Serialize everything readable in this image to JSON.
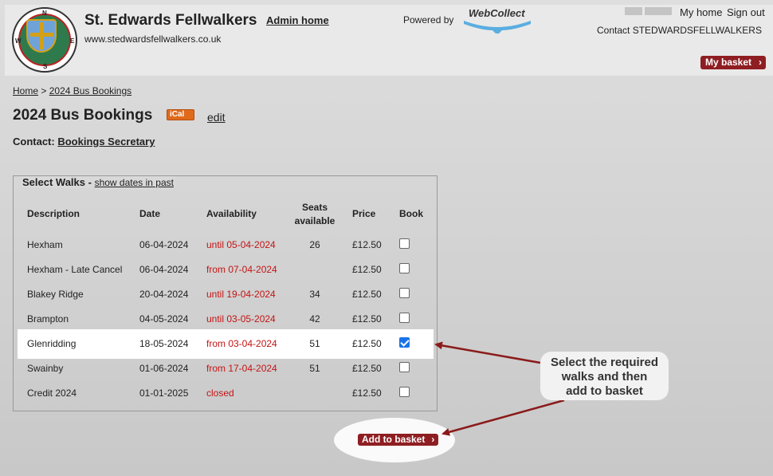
{
  "header": {
    "logo_letters": {
      "n": "N",
      "s": "S",
      "w": "W",
      "e": "E"
    },
    "site_title": "St. Edwards Fellwalkers",
    "admin_home": "Admin home",
    "site_url": "www.stedwardsfellwalkers.co.uk",
    "powered_by": "Powered by",
    "brand_logo_text": "WebCollect",
    "my_home": "My home",
    "sign_out": "Sign out",
    "contact": "Contact STEDWARDSFELLWALKERS",
    "basket_label": "My basket"
  },
  "breadcrumb": {
    "home": "Home",
    "separator": ">",
    "current": "2024 Bus Bookings"
  },
  "page": {
    "title": "2024 Bus Bookings",
    "ical_label": "iCal",
    "edit_label": "edit",
    "contact_label": "Contact:",
    "contact_name": "Bookings Secretary"
  },
  "walks": {
    "legend_title": "Select Walks -",
    "show_past_label": "show dates in past",
    "headers": {
      "description": "Description",
      "date": "Date",
      "availability": "Availability",
      "seats_line1": "Seats",
      "seats_line2": "available",
      "price": "Price",
      "book": "Book"
    },
    "rows": [
      {
        "description": "Hexham",
        "date": "06-04-2024",
        "availability": "until 05-04-2024",
        "seats": "26",
        "price": "£12.50",
        "checked": false
      },
      {
        "description": "Hexham - Late Cancel",
        "date": "06-04-2024",
        "availability": "from 07-04-2024",
        "seats": "",
        "price": "£12.50",
        "checked": false
      },
      {
        "description": "Blakey Ridge",
        "date": "20-04-2024",
        "availability": "until 19-04-2024",
        "seats": "34",
        "price": "£12.50",
        "checked": false
      },
      {
        "description": "Brampton",
        "date": "04-05-2024",
        "availability": "until 03-05-2024",
        "seats": "42",
        "price": "£12.50",
        "checked": false
      },
      {
        "description": "Glenridding",
        "date": "18-05-2024",
        "availability": "from 03-04-2024",
        "seats": "51",
        "price": "£12.50",
        "checked": true
      },
      {
        "description": "Swainby",
        "date": "01-06-2024",
        "availability": "from 17-04-2024",
        "seats": "51",
        "price": "£12.50",
        "checked": false
      },
      {
        "description": "Credit 2024",
        "date": "01-01-2025",
        "availability": "closed",
        "seats": "",
        "price": "£12.50",
        "checked": false
      }
    ]
  },
  "add_to_basket": "Add to basket",
  "callout": {
    "line1": "Select the required",
    "line2": "walks and then",
    "line3": "add to basket"
  },
  "colors": {
    "accent": "#8e1e22",
    "availability": "#c41414",
    "arrow": "#8b1a1a",
    "checkbox_checked": "#1a73e8"
  }
}
